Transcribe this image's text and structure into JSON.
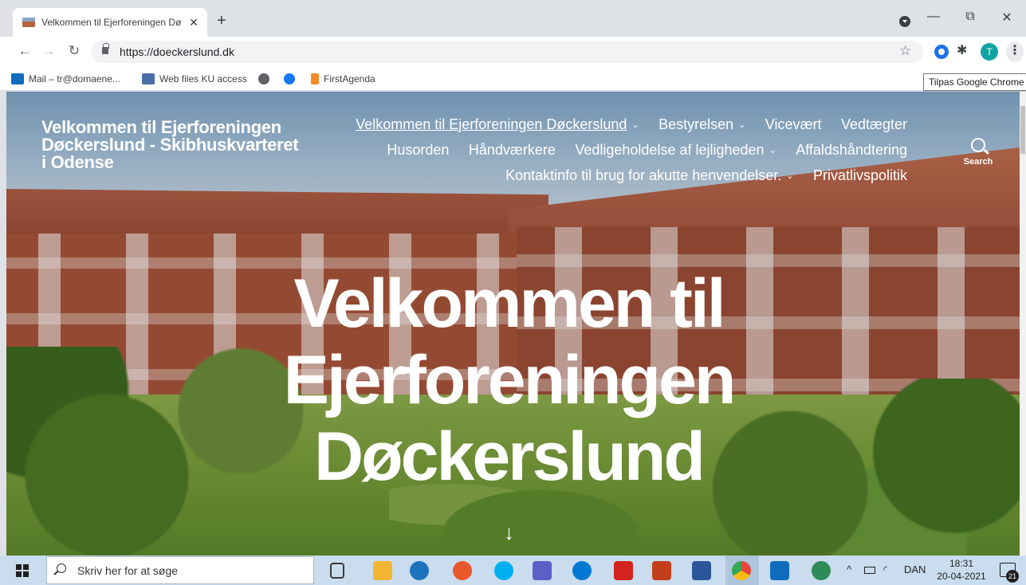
{
  "browser": {
    "tab_title": "Velkommen til Ejerforeningen Dø",
    "tab_close": "✕",
    "new_tab": "+",
    "window_controls": {
      "minimize": "—",
      "restore": "⧉",
      "close": "✕"
    },
    "nav": {
      "back": "←",
      "forward": "→",
      "reload": "↻"
    },
    "url": "https://doeckerslund.dk",
    "star": "☆",
    "profile_initial": "T",
    "menu": "⋮",
    "puzzle": "✱",
    "bookmarks": [
      {
        "label": "Mail – tr@domaene...",
        "icon": "outlook-icon",
        "color": "#0f6cbd"
      },
      {
        "label": "Web files KU access",
        "icon": "ku-icon",
        "color": "#4a6ea8"
      },
      {
        "label": "",
        "icon": "globe-icon",
        "color": "#5f6368"
      },
      {
        "label": "",
        "icon": "facebook-icon",
        "color": "#1877f2"
      },
      {
        "label": "FirstAgenda",
        "icon": "firstagenda-icon",
        "color": "#f28c28"
      }
    ],
    "tooltip": "Tilpas Google Chrome"
  },
  "site": {
    "title": "Velkommen til Ejerforeningen Døckerslund - Skibhuskvarteret i Odense",
    "nav": [
      {
        "label": "Velkommen til Ejerforeningen Døckerslund",
        "caret": true,
        "current": true
      },
      {
        "label": "Bestyrelsen",
        "caret": true,
        "current": false
      },
      {
        "label": "Vicevært",
        "caret": false,
        "current": false
      },
      {
        "label": "Vedtægter",
        "caret": false,
        "current": false
      },
      {
        "label": "Husorden",
        "caret": false,
        "current": false
      },
      {
        "label": "Håndværkere",
        "caret": false,
        "current": false
      },
      {
        "label": "Vedligeholdelse af lejligheden",
        "caret": true,
        "current": false
      },
      {
        "label": "Affaldshåndtering",
        "caret": false,
        "current": false
      },
      {
        "label": "Kontaktinfo til brug for akutte henvendelser.",
        "caret": true,
        "current": false
      },
      {
        "label": "Privatlivspolitik",
        "caret": false,
        "current": false
      }
    ],
    "caret_glyph": "⌄",
    "search_label": "Search",
    "hero_title": "Velkommen til Ejerforeningen Døckerslund",
    "scroll_arrow": "↓"
  },
  "taskbar": {
    "search_placeholder": "Skriv her for at søge",
    "apps": [
      {
        "icon": "task-view-icon",
        "color": "#3a3a3a"
      },
      {
        "icon": "file-explorer-icon",
        "color": "#f2b632"
      },
      {
        "icon": "edge-legacy-icon",
        "color": "#1e73be"
      },
      {
        "icon": "firefox-icon",
        "color": "#e8562a"
      },
      {
        "icon": "skype-icon",
        "color": "#00aff0"
      },
      {
        "icon": "teams-icon",
        "color": "#5b5fc7"
      },
      {
        "icon": "skype-business-icon",
        "color": "#0078d4"
      },
      {
        "icon": "acrobat-icon",
        "color": "#d4231f"
      },
      {
        "icon": "powerpoint-icon",
        "color": "#c43e1c"
      },
      {
        "icon": "word-icon",
        "color": "#2b579a"
      },
      {
        "icon": "chrome-icon",
        "color": "#e8453c"
      },
      {
        "icon": "outlook-icon",
        "color": "#0f6cbd"
      },
      {
        "icon": "globe-app-icon",
        "color": "#2e8b57"
      }
    ],
    "tray_chevron": "^",
    "language": "DAN",
    "time": "18:31",
    "date": "20-04-2021",
    "notifications": "21"
  }
}
